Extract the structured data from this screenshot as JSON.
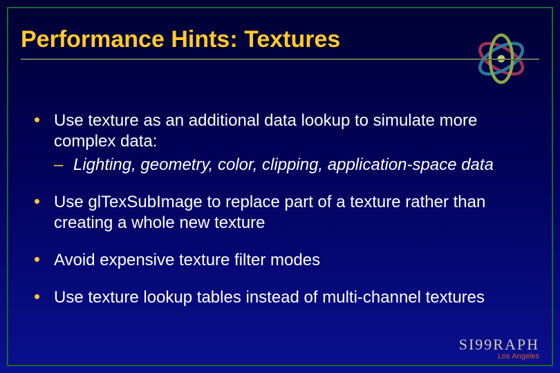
{
  "slide": {
    "title": "Performance Hints:  Textures",
    "bullets": [
      {
        "text": "Use texture as an additional data lookup to simulate more complex data:",
        "sub": "Lighting, geometry, color, clipping, application-space data"
      },
      {
        "text": "Use glTexSubImage to replace part of a texture rather than creating a whole new texture"
      },
      {
        "text": "Avoid expensive texture filter modes"
      },
      {
        "text": "Use texture lookup tables instead of multi-channel textures"
      }
    ],
    "footer": {
      "brand": "SI99RAPH",
      "location": "Los Angeles"
    }
  }
}
